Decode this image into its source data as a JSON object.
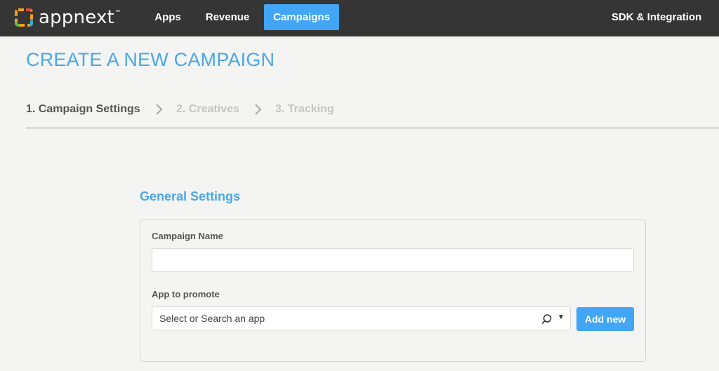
{
  "header": {
    "logo_text": "appnext",
    "logo_tm": "™",
    "nav": {
      "apps": "Apps",
      "revenue": "Revenue",
      "campaigns": "Campaigns",
      "sdk": "SDK & Integration"
    },
    "active_tab": "Campaigns",
    "accent_color": "#42a5f5"
  },
  "page": {
    "title": "CREATE A NEW CAMPAIGN"
  },
  "steps": [
    {
      "label": "1. Campaign Settings",
      "state": "active"
    },
    {
      "label": "2. Creatives",
      "state": "inactive"
    },
    {
      "label": "3. Tracking",
      "state": "inactive"
    }
  ],
  "general_settings": {
    "title": "General Settings",
    "campaign_name_label": "Campaign Name",
    "campaign_name_value": "",
    "app_label": "App to promote",
    "app_placeholder": "Select or Search an app",
    "add_new_label": "Add new"
  },
  "icons": {
    "logo": "appnext-logo-icon",
    "step_separator": "chevron-right-icon",
    "search": "search-icon",
    "dropdown": "caret-down-icon"
  }
}
